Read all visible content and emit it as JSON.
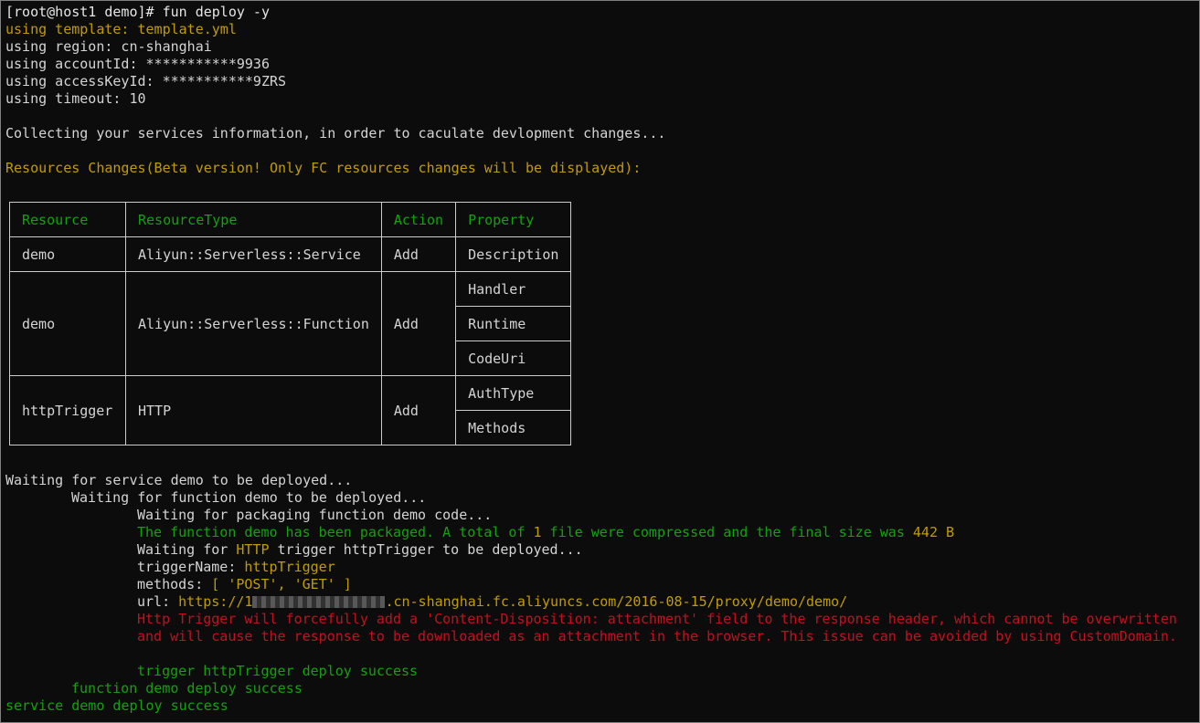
{
  "terminal": {
    "prompt": "[root@host1 demo]# ",
    "command": "fun deploy -y",
    "config_lines": {
      "template": "using template: template.yml",
      "region": "using region: cn-shanghai",
      "account_id": "using accountId: ***********9936",
      "access_key_id": "using accessKeyId: ***********9ZRS",
      "timeout": "using timeout: 10"
    },
    "collecting": "Collecting your services information, in order to caculate devlopment changes...",
    "resources_changes": "Resources Changes(Beta version! Only FC resources changes will be displayed):"
  },
  "table": {
    "headers": [
      "Resource",
      "ResourceType",
      "Action",
      "Property"
    ],
    "rows": [
      {
        "resource": "demo",
        "type": "Aliyun::Serverless::Service",
        "action": "Add",
        "properties": [
          "Description"
        ]
      },
      {
        "resource": "demo",
        "type": "Aliyun::Serverless::Function",
        "action": "Add",
        "properties": [
          "Handler",
          "Runtime",
          "CodeUri"
        ]
      },
      {
        "resource": "httpTrigger",
        "type": "HTTP",
        "action": "Add",
        "properties": [
          "AuthType",
          "Methods"
        ]
      }
    ]
  },
  "deploy": {
    "wait_service": "Waiting for service demo to be deployed...",
    "wait_function": "Waiting for function demo to be deployed...",
    "wait_packaging": "Waiting for packaging function demo code...",
    "packaged_pre": "The function demo has been packaged. A total of ",
    "packaged_count": "1",
    "packaged_mid": " file were compressed and the final size was ",
    "packaged_size": "442 B",
    "wait_trigger_pre": "Waiting for ",
    "wait_trigger_http": "HTTP",
    "wait_trigger_post": " trigger httpTrigger to be deployed...",
    "trigger_name_label": "triggerName: ",
    "trigger_name_value": "httpTrigger",
    "methods_label": "methods: ",
    "methods_value": "[ 'POST', 'GET' ]",
    "url_label": "url: ",
    "url_prefix": "https://1",
    "url_suffix": ".cn-shanghai.fc.aliyuncs.com/2016-08-15/proxy/demo/demo/",
    "warning_line1": "Http Trigger will forcefully add a 'Content-Disposition: attachment' field to the response header, which cannot be overwritten",
    "warning_line2": "and will cause the response to be downloaded as an attachment in the browser. This issue can be avoided by using CustomDomain.",
    "trigger_success": "trigger httpTrigger deploy success",
    "function_success": "function demo deploy success",
    "service_success": "service demo deploy success"
  },
  "colors": {
    "background": "#0c0c0c",
    "text": "#cccccc",
    "yellow": "#c19c00",
    "green": "#13a10e",
    "red": "#c50f1f"
  }
}
